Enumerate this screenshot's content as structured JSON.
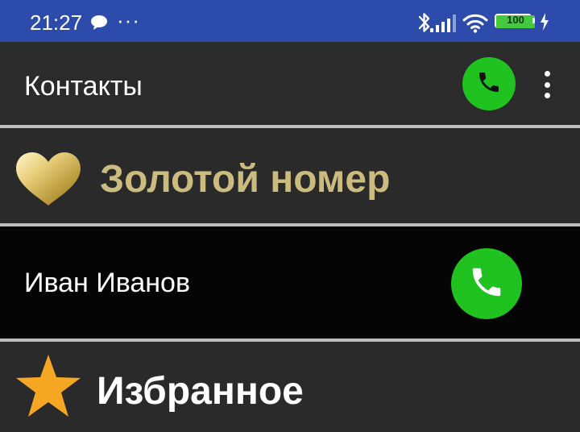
{
  "status_bar": {
    "time": "21:27",
    "more": "···",
    "battery": "100",
    "icons": [
      "chat-bubble-icon",
      "bluetooth-icon",
      "signal-icon",
      "wifi-icon",
      "battery-icon",
      "charging-icon"
    ]
  },
  "app_bar": {
    "title": "Контакты",
    "call_icon": "phone-icon",
    "menu_icon": "overflow-menu-icon"
  },
  "sections": {
    "gold": {
      "label": "Золотой номер",
      "icon": "heart-icon"
    },
    "favorites": {
      "label": "Избранное",
      "icon": "star-icon"
    }
  },
  "contacts": [
    {
      "name": "Иван Иванов",
      "call_icon": "phone-icon"
    }
  ],
  "colors": {
    "status_bar": "#2d4bab",
    "call_green": "#1fc21f",
    "gold_text": "#cbbb7f",
    "star": "#f5a623",
    "divider": "#bdbdbd"
  }
}
